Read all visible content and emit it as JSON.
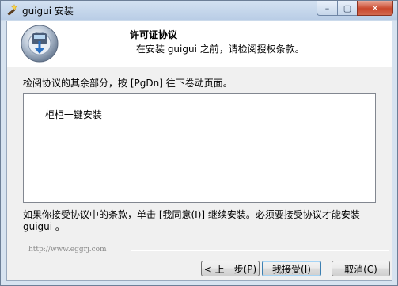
{
  "window": {
    "title": "guigui 安装",
    "controls": {
      "minimize": "–",
      "maximize": "▢",
      "close": "✕"
    }
  },
  "header": {
    "title": "许可证协议",
    "subtitle": "在安装 guigui  之前，请检阅授权条款。"
  },
  "body": {
    "instruction": "检阅协议的其余部分，按 [PgDn] 往下卷动页面。",
    "license_text": "柜柜一键安装",
    "accept_note": "如果你接受协议中的条款，单击 [我同意(I)] 继续安装。必须要接受协议才能安装 guigui  。"
  },
  "footer": {
    "brand": "http://www.eggrj.com",
    "buttons": {
      "back": "< 上一步(P)",
      "accept": "我接受(I)",
      "cancel": "取消(C)"
    }
  },
  "colors": {
    "titlebar": "#c9d9ec",
    "close_button": "#c9472c",
    "client_bg": "#f0f0f0",
    "default_button_border": "#3c7fb1"
  },
  "icons": {
    "app": "installer-wand-icon",
    "header_logo": "install-disc-icon"
  }
}
